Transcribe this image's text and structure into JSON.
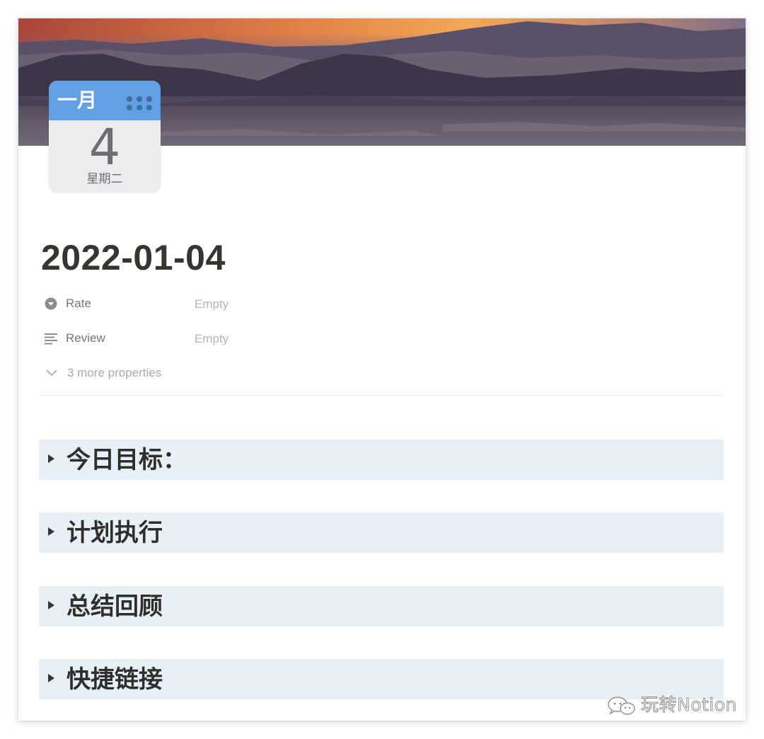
{
  "cover": {
    "icon_name": "desert-sunset-landscape",
    "colors": {
      "sky_top": "#d9673a",
      "sky_mid": "#f0a35a",
      "mountains": "#3d3548",
      "ground": "#5f5668"
    }
  },
  "page_icon": {
    "icon_name": "calendar-icon",
    "month": "一月",
    "day": "4",
    "weekday": "星期二",
    "colors": {
      "header": "#62a0e4",
      "body": "#ececee",
      "dots": "#3f6f9f"
    }
  },
  "page": {
    "title": "2022-01-04"
  },
  "properties": [
    {
      "name": "Rate",
      "value": "Empty",
      "icon": "select-circle-icon"
    },
    {
      "name": "Review",
      "value": "Empty",
      "icon": "text-lines-icon"
    }
  ],
  "more_properties": {
    "label": "3 more properties",
    "icon": "chevron-down-icon"
  },
  "toggles": [
    {
      "label": "今日目标："
    },
    {
      "label": "计划执行"
    },
    {
      "label": "总结回顾"
    },
    {
      "label": "快捷链接"
    }
  ],
  "toggle_background": "#e8f0f7",
  "watermark": {
    "text": "玩转Notion",
    "icon": "wechat-icon"
  }
}
